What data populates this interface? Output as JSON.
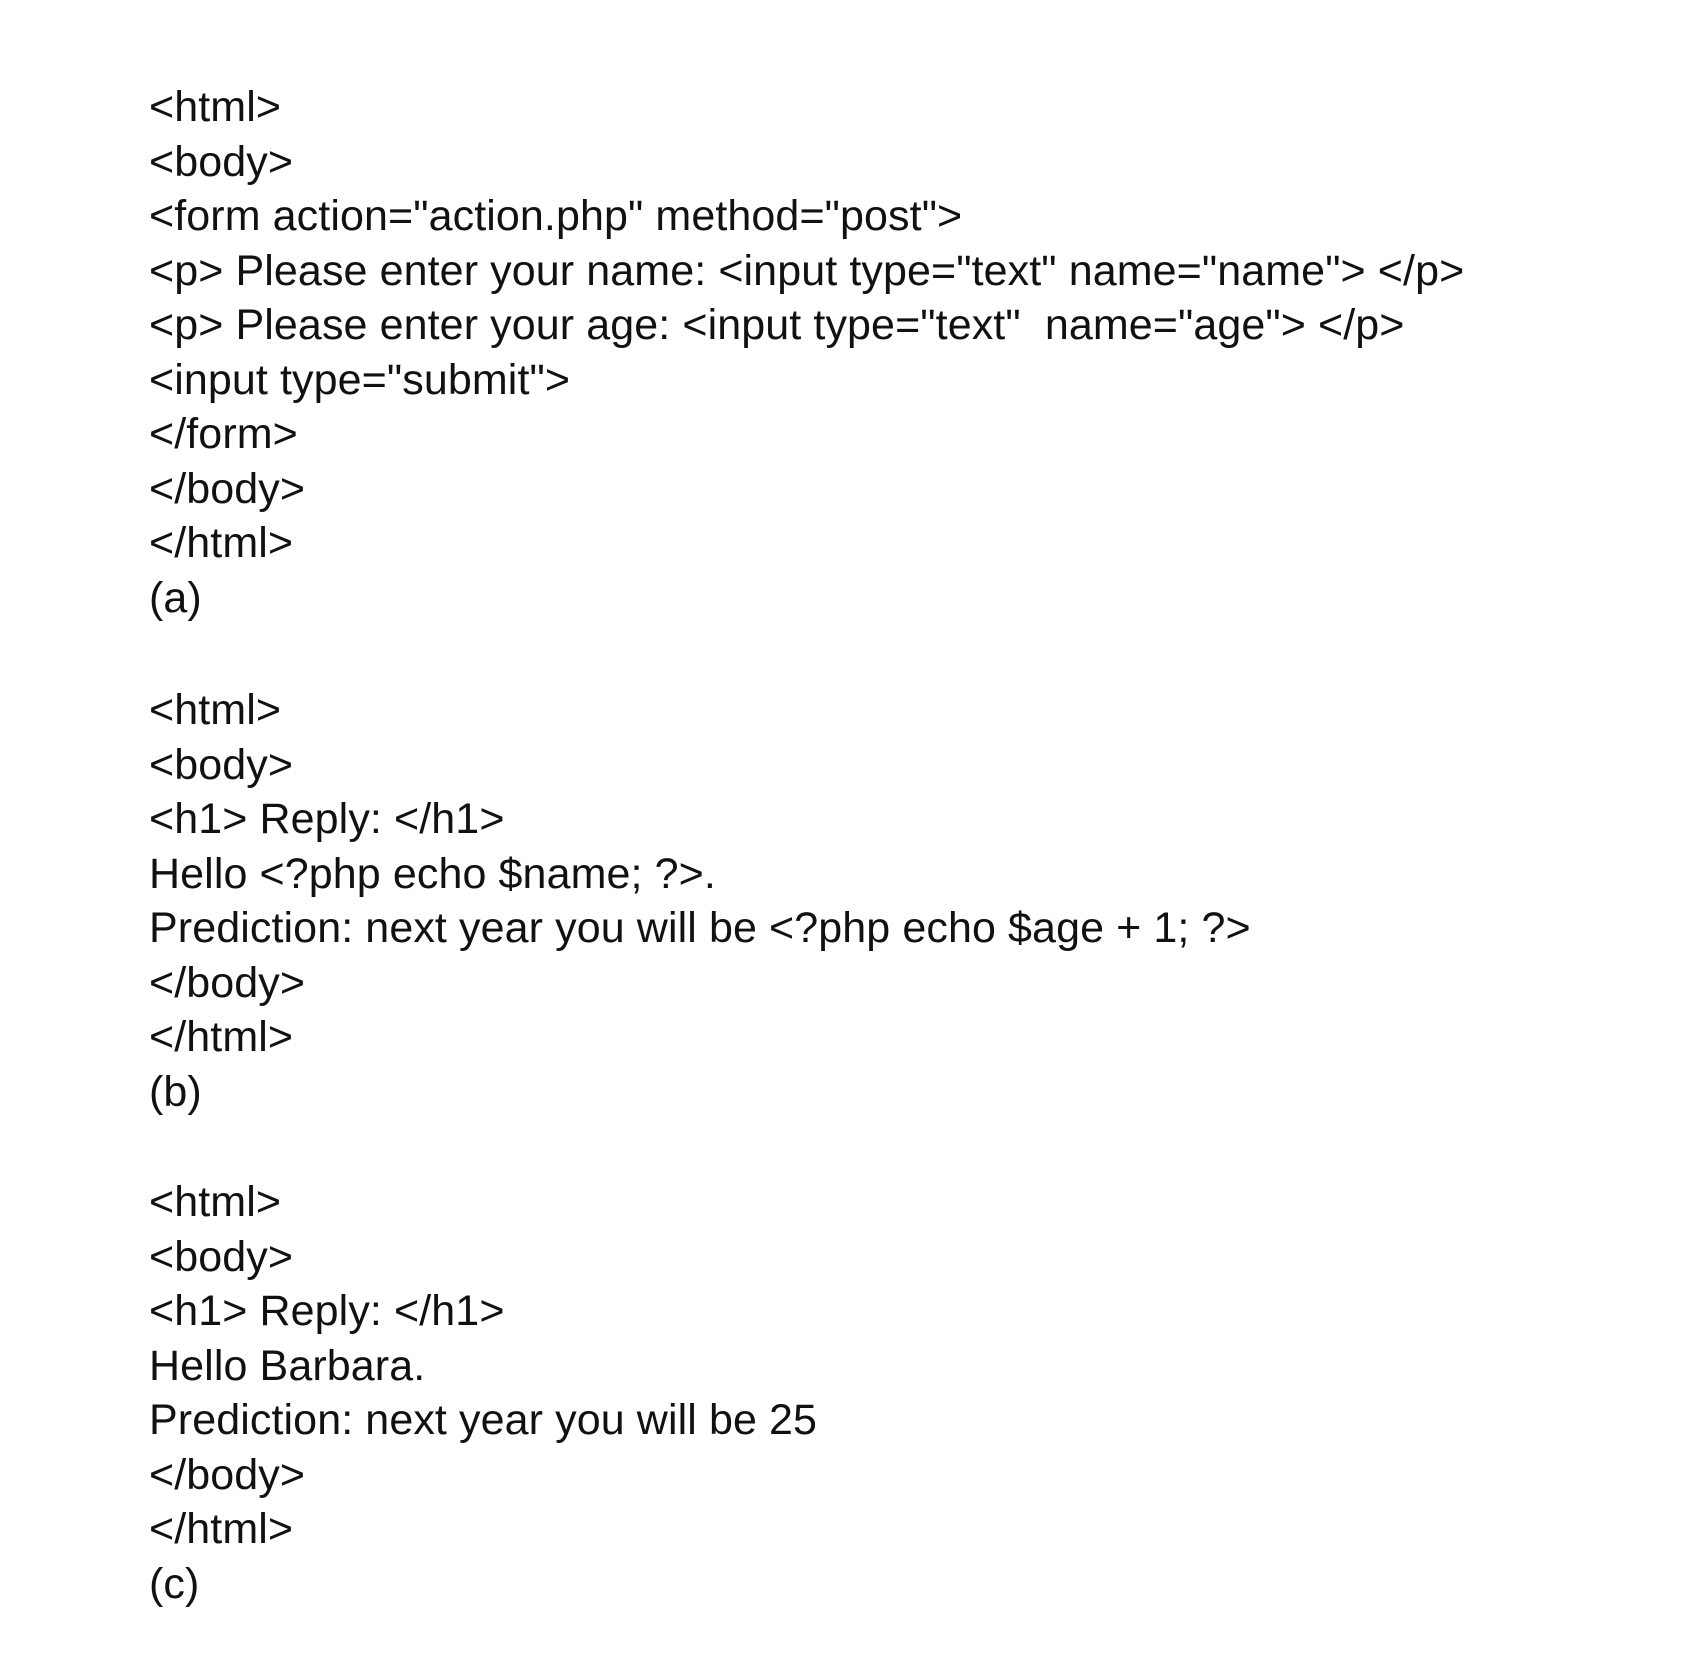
{
  "figures": [
    {
      "lines": [
        "<html>",
        "<body>",
        "<form action=\"action.php\" method=\"post\">",
        "<p> Please enter your name: <input type=\"text\" name=\"name\"> </p>",
        "<p> Please enter your age: <input type=\"text\"  name=\"age\"> </p>",
        "<input type=\"submit\">",
        "</form>",
        "</body>",
        "</html>"
      ],
      "caption": "(a)"
    },
    {
      "lines": [
        "<html>",
        "<body>",
        "<h1> Reply: </h1>",
        "Hello <?php echo $name; ?>.",
        "Prediction: next year you will be <?php echo $age + 1; ?>",
        "</body>",
        "</html>"
      ],
      "caption": "(b)"
    },
    {
      "lines": [
        "<html>",
        "<body>",
        "<h1> Reply: </h1>",
        "Hello Barbara.",
        "Prediction: next year you will be 25",
        "</body>",
        "</html>"
      ],
      "caption": "(c)"
    }
  ]
}
